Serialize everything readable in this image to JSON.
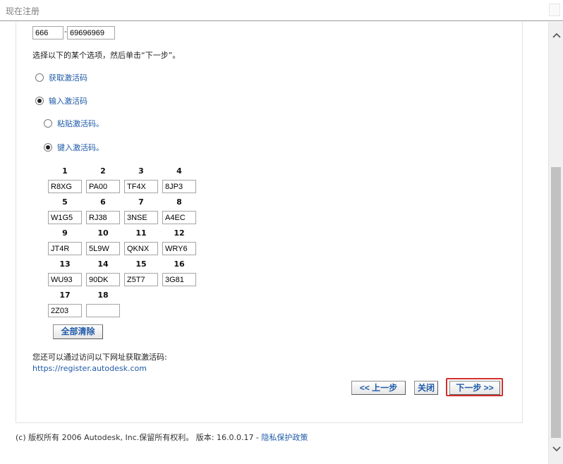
{
  "window": {
    "title": "现在注册"
  },
  "request_code": {
    "part1": "666",
    "separator": "-",
    "part2": "69696969"
  },
  "instruction": "选择以下的某个选项，然后单击“下一步”。",
  "options": {
    "get_code": {
      "label": "获取激活码",
      "selected": false
    },
    "enter_code": {
      "label": "输入激活码",
      "selected": true
    },
    "paste_code": {
      "label": "粘贴激活码。",
      "selected": false
    },
    "type_code": {
      "label": "键入激活码。",
      "selected": true
    }
  },
  "activation_fields": [
    {
      "num": "1",
      "value": "R8XG"
    },
    {
      "num": "2",
      "value": "PA00"
    },
    {
      "num": "3",
      "value": "TF4X"
    },
    {
      "num": "4",
      "value": "8JP3"
    },
    {
      "num": "5",
      "value": "W1G5"
    },
    {
      "num": "6",
      "value": "RJ38"
    },
    {
      "num": "7",
      "value": "3NSE"
    },
    {
      "num": "8",
      "value": "A4EC"
    },
    {
      "num": "9",
      "value": "JT4R"
    },
    {
      "num": "10",
      "value": "5L9W"
    },
    {
      "num": "11",
      "value": "QKNX"
    },
    {
      "num": "12",
      "value": "WRY6"
    },
    {
      "num": "13",
      "value": "WU93"
    },
    {
      "num": "14",
      "value": "90DK"
    },
    {
      "num": "15",
      "value": "Z5T7"
    },
    {
      "num": "16",
      "value": "3G81"
    },
    {
      "num": "17",
      "value": "2Z03"
    },
    {
      "num": "18",
      "value": ""
    }
  ],
  "buttons": {
    "clear_all": "全部清除",
    "back": "<< 上一步",
    "close": "关闭",
    "next": "下一步 >>"
  },
  "url_note": "您还可以通过访问以下网址获取激活码:",
  "url": "https://register.autodesk.com",
  "footer": {
    "copyright": "(c) 版权所有 2006 Autodesk, Inc.保留所有权利。 版本: 16.0.0.17 - ",
    "privacy_link": "隐私保护政策"
  },
  "icons": {
    "scroll_up": "chevron-up-icon",
    "scroll_down": "chevron-down-icon"
  },
  "colors": {
    "link": "#1f5aa8",
    "highlight": "#d32f2f"
  }
}
